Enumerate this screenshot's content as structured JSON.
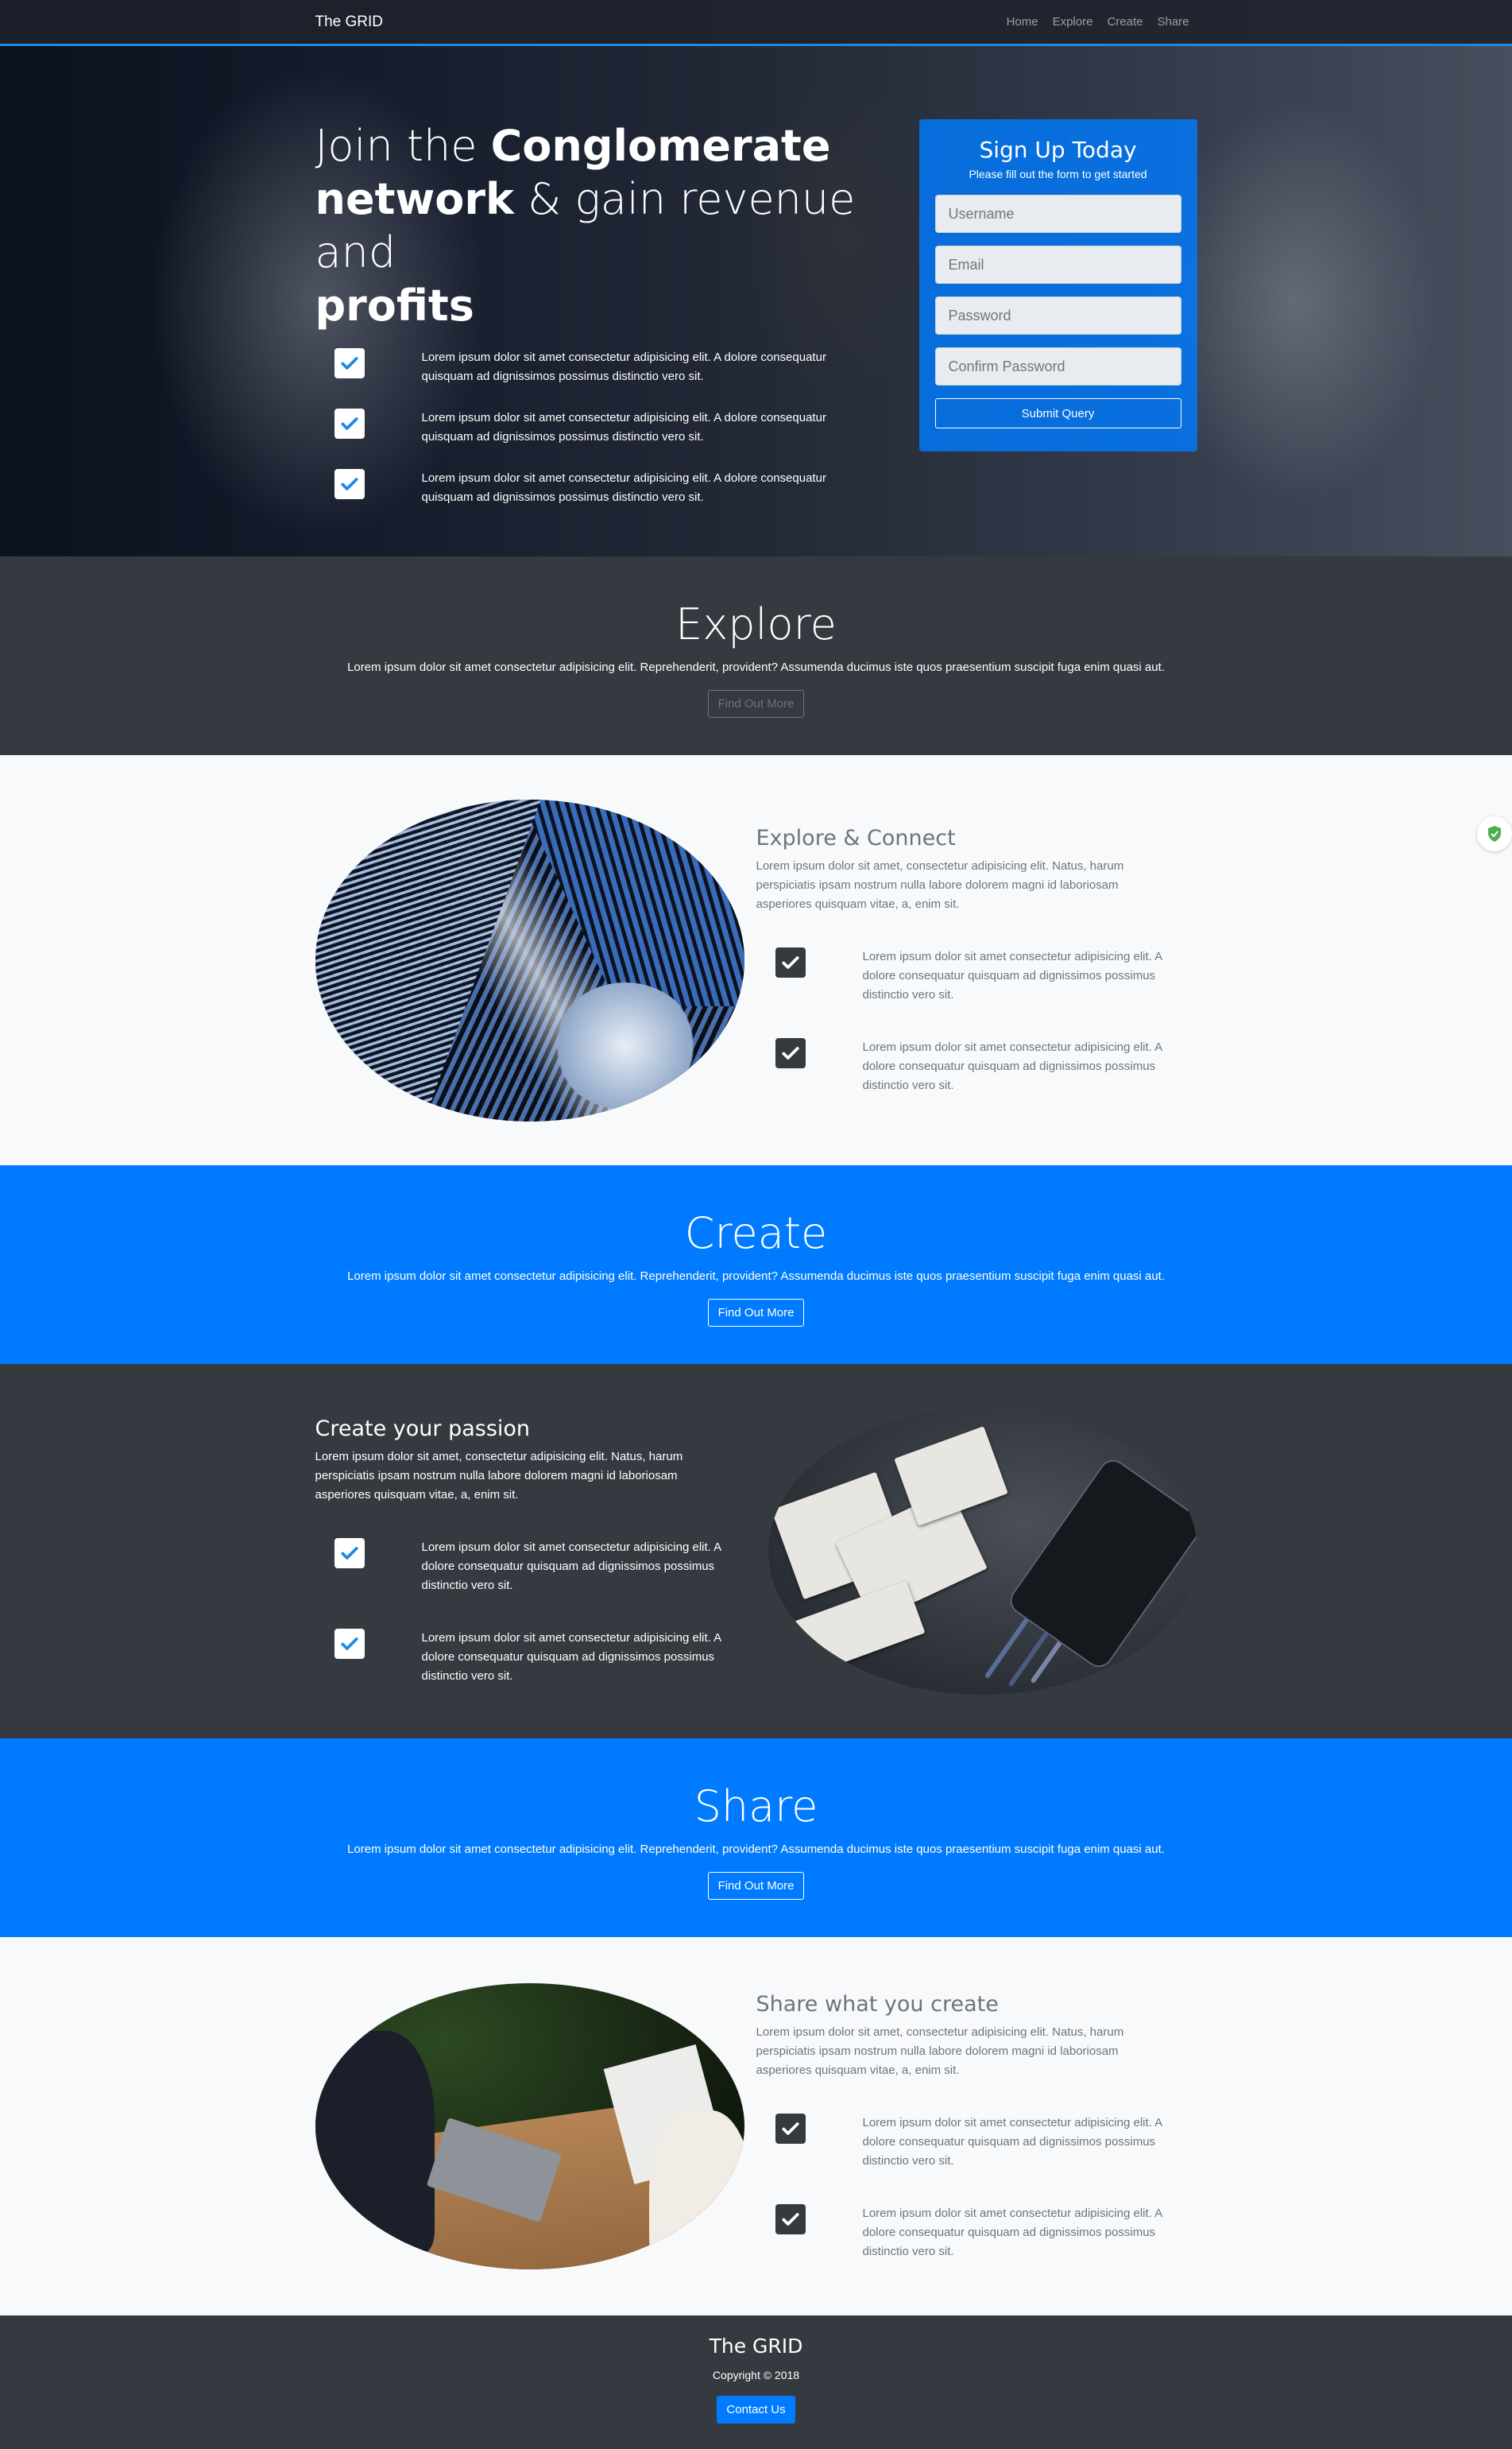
{
  "nav": {
    "brand": "The GRID",
    "links": [
      "Home",
      "Explore",
      "Create",
      "Share"
    ]
  },
  "hero": {
    "title_part1": "Join the ",
    "title_bold1": "Conglomerate",
    "title_bold2": "network",
    "title_part2": " & gain revenue and ",
    "title_bold3": "profits",
    "features": [
      "Lorem ipsum dolor sit amet consectetur adipisicing elit. A dolore consequatur quisquam ad dignissimos possimus distinctio vero sit.",
      "Lorem ipsum dolor sit amet consectetur adipisicing elit. A dolore consequatur quisquam ad dignissimos possimus distinctio vero sit.",
      "Lorem ipsum dolor sit amet consectetur adipisicing elit. A dolore consequatur quisquam ad dignissimos possimus distinctio vero sit."
    ]
  },
  "signup": {
    "title": "Sign Up Today",
    "subtitle": "Please fill out the form to get started",
    "username_placeholder": "Username",
    "email_placeholder": "Email",
    "password_placeholder": "Password",
    "confirm_placeholder": "Confirm Password",
    "submit_label": "Submit Query"
  },
  "explore": {
    "heading": "Explore",
    "text": "Lorem ipsum dolor sit amet consectetur adipisicing elit. Reprehenderit, provident? Assumenda ducimus iste quos praesentium suscipit fuga enim quasi aut.",
    "button": "Find Out More"
  },
  "explore_connect": {
    "heading": "Explore & Connect",
    "lead": "Lorem ipsum dolor sit amet, consectetur adipisicing elit. Natus, harum perspiciatis ipsam nostrum nulla labore dolorem magni id laboriosam asperiores quisquam vitae, a, enim sit.",
    "features": [
      "Lorem ipsum dolor sit amet consectetur adipisicing elit. A dolore consequatur quisquam ad dignissimos possimus distinctio vero sit.",
      "Lorem ipsum dolor sit amet consectetur adipisicing elit. A dolore consequatur quisquam ad dignissimos possimus distinctio vero sit."
    ]
  },
  "create": {
    "heading": "Create",
    "text": "Lorem ipsum dolor sit amet consectetur adipisicing elit. Reprehenderit, provident? Assumenda ducimus iste quos praesentium suscipit fuga enim quasi aut.",
    "button": "Find Out More"
  },
  "create_passion": {
    "heading": "Create your passion",
    "lead": "Lorem ipsum dolor sit amet, consectetur adipisicing elit. Natus, harum perspiciatis ipsam nostrum nulla labore dolorem magni id laboriosam asperiores quisquam vitae, a, enim sit.",
    "features": [
      "Lorem ipsum dolor sit amet consectetur adipisicing elit. A dolore consequatur quisquam ad dignissimos possimus distinctio vero sit.",
      "Lorem ipsum dolor sit amet consectetur adipisicing elit. A dolore consequatur quisquam ad dignissimos possimus distinctio vero sit."
    ]
  },
  "share": {
    "heading": "Share",
    "text": "Lorem ipsum dolor sit amet consectetur adipisicing elit. Reprehenderit, provident? Assumenda ducimus iste quos praesentium suscipit fuga enim quasi aut.",
    "button": "Find Out More"
  },
  "share_create": {
    "heading": "Share what you create",
    "lead": "Lorem ipsum dolor sit amet, consectetur adipisicing elit. Natus, harum perspiciatis ipsam nostrum nulla labore dolorem magni id laboriosam asperiores quisquam vitae, a, enim sit.",
    "features": [
      "Lorem ipsum dolor sit amet consectetur adipisicing elit. A dolore consequatur quisquam ad dignissimos possimus distinctio vero sit.",
      "Lorem ipsum dolor sit amet consectetur adipisicing elit. A dolore consequatur quisquam ad dignissimos possimus distinctio vero sit."
    ]
  },
  "footer": {
    "brand": "The GRID",
    "copyright": "Copyright © 2018",
    "contact": "Contact Us"
  },
  "colors": {
    "primary": "#007bff",
    "dark": "#343a40",
    "light": "#f8f9fa"
  }
}
